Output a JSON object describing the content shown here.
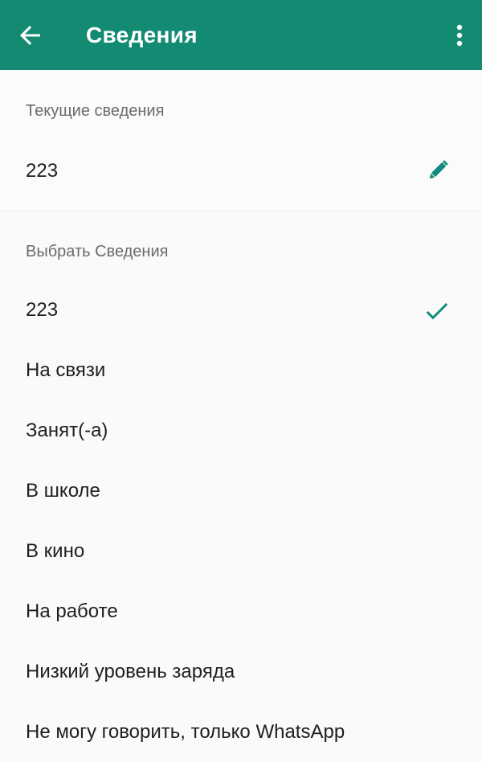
{
  "toolbar": {
    "title": "Сведения",
    "back_icon": "arrow-back-icon",
    "more_icon": "more-vert-icon"
  },
  "current": {
    "header": "Текущие сведения",
    "value": "223",
    "edit_icon": "pencil-icon"
  },
  "select": {
    "header": "Выбрать Сведения",
    "items": [
      {
        "label": "223",
        "selected": true
      },
      {
        "label": "На связи",
        "selected": false
      },
      {
        "label": "Занят(-а)",
        "selected": false
      },
      {
        "label": "В школе",
        "selected": false
      },
      {
        "label": "В кино",
        "selected": false
      },
      {
        "label": "На работе",
        "selected": false
      },
      {
        "label": "Низкий уровень заряда",
        "selected": false
      },
      {
        "label": "Не могу говорить, только WhatsApp",
        "selected": false
      }
    ],
    "check_icon": "checkmark-icon"
  },
  "colors": {
    "toolbar": "#138a72",
    "accent": "#128c7e",
    "background": "#fafafa",
    "text_primary": "#1f1f1f",
    "text_secondary": "#6b6b6b"
  }
}
